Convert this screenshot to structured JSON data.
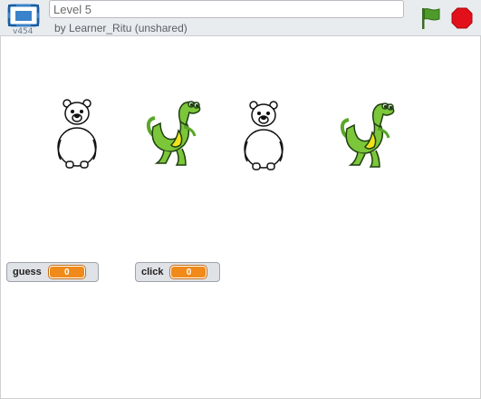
{
  "header": {
    "version": "v454",
    "project_title": "Level 5",
    "byline": "by Learner_Ritu (unshared)",
    "green_flag_icon": "green-flag-icon",
    "stop_icon": "stop-sign-icon"
  },
  "stage": {
    "sprites": [
      {
        "name": "polar-bear",
        "icon": "polar-bear-icon"
      },
      {
        "name": "dinosaur",
        "icon": "dinosaur-icon"
      },
      {
        "name": "polar-bear",
        "icon": "polar-bear-icon"
      },
      {
        "name": "dinosaur",
        "icon": "dinosaur-icon"
      }
    ],
    "monitors": [
      {
        "label": "guess",
        "value": "0"
      },
      {
        "label": "click",
        "value": "0"
      }
    ]
  },
  "colors": {
    "monitor_value_bg": "#f08a1a",
    "flag_green": "#4e9a2a",
    "stop_red": "#e2101a",
    "topbar_bg": "#e9ecef"
  }
}
